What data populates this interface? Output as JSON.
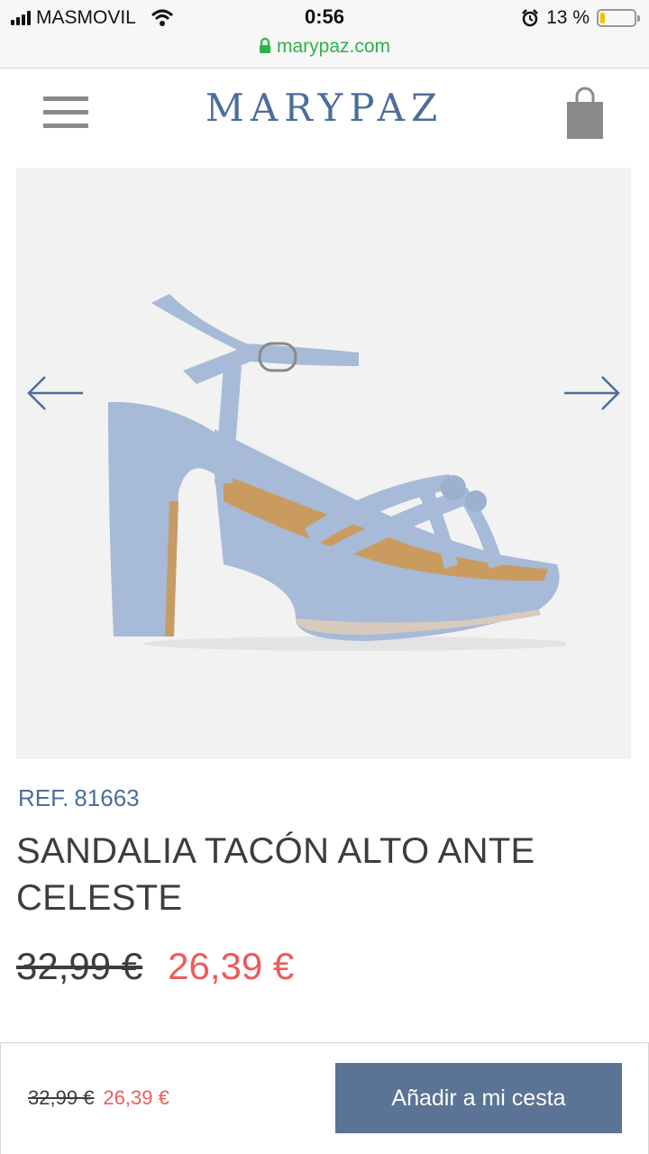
{
  "status": {
    "carrier": "MASMOVIL",
    "time": "0:56",
    "battery_text": "13 %",
    "battery_level": 0.13
  },
  "browser": {
    "url": "marypaz.com"
  },
  "header": {
    "brand": "MARYPAZ",
    "menu_icon": "hamburger-icon",
    "cart_icon": "shopping-bag-icon"
  },
  "product": {
    "ref_label": "REF.",
    "ref_number": "81663",
    "title": "SANDALIA TACÓN ALTO ANTE CELESTE",
    "old_price": "32,99 €",
    "new_price": "26,39 €"
  },
  "bottom_bar": {
    "old_price": "32,99 €",
    "new_price": "26,39 €",
    "add_to_cart_label": "Añadir a mi cesta"
  },
  "colors": {
    "brand_blue": "#4b6e9a",
    "price_red": "#ee5a5a",
    "button_bg": "#5b7395",
    "secure_green": "#2db24a"
  }
}
